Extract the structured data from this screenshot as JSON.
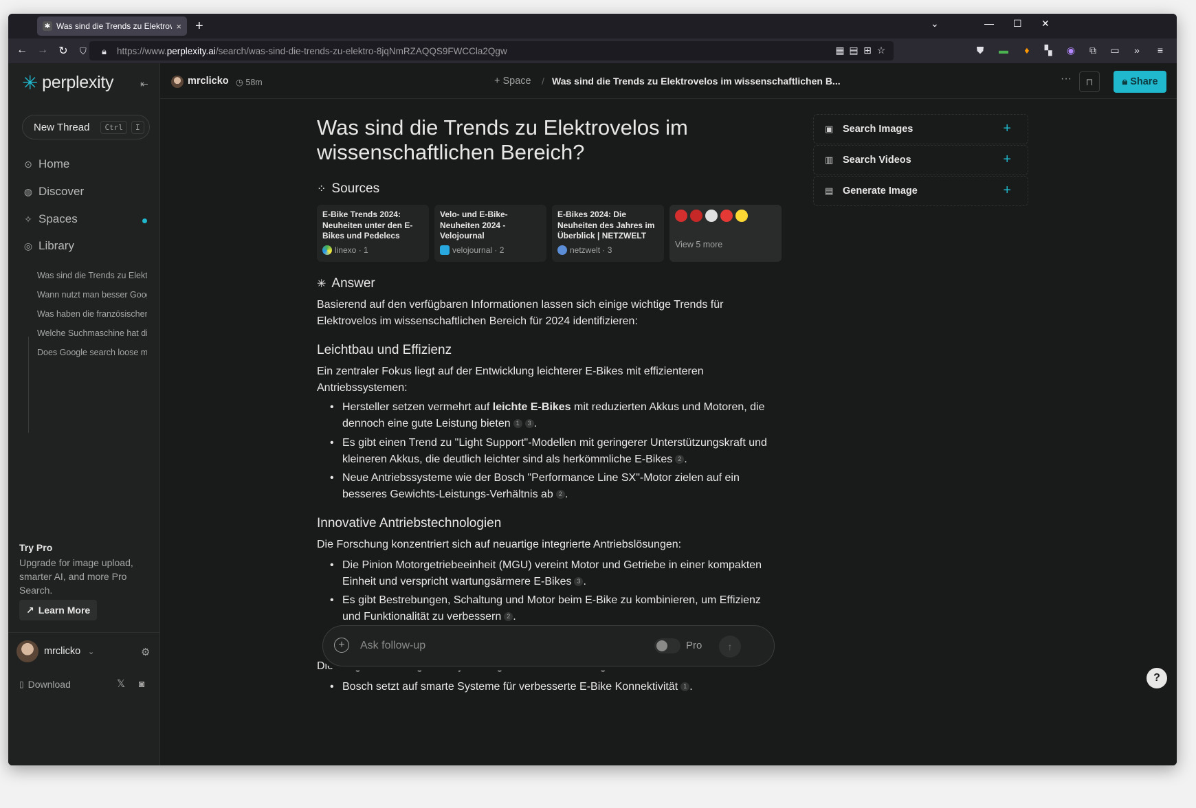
{
  "browser": {
    "tab_title": "Was sind die Trends zu Elektrovelos",
    "tab_close": "×",
    "new_tab": "+",
    "url_prefix": "https://www.",
    "url_host": "perplexity.ai",
    "url_path": "/search/was-sind-die-trends-zu-elektro-8jqNmRZAQQS9FWCCla2Qgw"
  },
  "sidebar": {
    "brand": "perplexity",
    "new_thread_label": "New Thread",
    "shortcut_key1": "Ctrl",
    "shortcut_key2": "I",
    "nav": [
      {
        "label": "Home"
      },
      {
        "label": "Discover"
      },
      {
        "label": "Spaces"
      },
      {
        "label": "Library"
      }
    ],
    "library_items": [
      "Was sind die Trends zu Elektrovelos",
      "Wann nutzt man besser Google",
      "Was haben die französischen",
      "Welche Suchmaschine hat die",
      "Does Google search loose market"
    ],
    "try_pro_title": "Try Pro",
    "try_pro_text": "Upgrade for image upload, smarter AI, and more Pro Search.",
    "learn_more": "Learn More",
    "username": "mrclicko",
    "download": "Download"
  },
  "header": {
    "username": "mrclicko",
    "time": "58m",
    "space": "Space",
    "separator": "/",
    "title": "Was sind die Trends zu Elektrovelos im wissenschaftlichen B...",
    "share": "Share"
  },
  "main": {
    "question": "Was sind die Trends zu Elektrovelos im wissenschaftlichen Bereich?",
    "sources_heading": "Sources",
    "sources": [
      {
        "title": "E-Bike Trends 2024: Neuheiten unter den E-Bikes und Pedelecs",
        "site": "linexo",
        "num": "1"
      },
      {
        "title": "Velo- und E-Bike-Neuheiten 2024 - Velojournal",
        "site": "velojournal",
        "num": "2"
      },
      {
        "title": "E-Bikes 2024: Die Neuheiten des Jahres im Überblick | NETZWELT",
        "site": "netzwelt",
        "num": "3"
      }
    ],
    "view_more": "View 5 more",
    "answer_heading": "Answer",
    "intro": "Basierend auf den verfügbaren Informationen lassen sich einige wichtige Trends für Elektrovelos im wissenschaftlichen Bereich für 2024 identifizieren:",
    "section1_title": "Leichtbau und Effizienz",
    "section1_intro": "Ein zentraler Fokus liegt auf der Entwicklung leichterer E-Bikes mit effizienteren Antriebssystemen:",
    "b1_pre": "Hersteller setzen vermehrt auf ",
    "b1_bold": "leichte E-Bikes",
    "b1_post": " mit reduzierten Akkus und Motoren, die dennoch eine gute Leistung bieten",
    "b1_c1": "1",
    "b1_c2": "3",
    "b2_text": "Es gibt einen Trend zu \"Light Support\"-Modellen mit geringerer Unterstützungskraft und kleineren Akkus, die deutlich leichter sind als herkömmliche E-Bikes",
    "b2_c1": "2",
    "b3_text": "Neue Antriebssysteme wie der Bosch \"Performance Line SX\"-Motor zielen auf ein besseres Gewichts-Leistungs-Verhältnis ab",
    "b3_c1": "2",
    "section2_title": "Innovative Antriebstechnologien",
    "section2_intro": "Die Forschung konzentriert sich auf neuartige integrierte Antriebslösungen:",
    "b4_text": "Die Pinion Motorgetriebeeinheit (MGU) vereint Motor und Getriebe in einer kompakten Einheit und verspricht wartungsärmere E-Bikes",
    "b4_c1": "3",
    "b5_text": "Es gibt Bestrebungen, Schaltung und Motor beim E-Bike zu kombinieren, um Effizienz und Funktionalität zu verbessern",
    "b5_c1": "2",
    "section3_intro": "Die Integration intelligenter Systeme gewinnt an Bedeutung:",
    "b6_text": "Bosch setzt auf smarte Systeme für verbesserte E-Bike Konnektivität",
    "b6_c1": "1"
  },
  "right_panel": {
    "search_images": "Search Images",
    "search_videos": "Search Videos",
    "generate_image": "Generate Image"
  },
  "followup": {
    "placeholder": "Ask follow-up",
    "pro_label": "Pro",
    "pro_enabled": false
  },
  "help": "?",
  "colors": {
    "accent": "#20b8cd",
    "background": "#191a1a",
    "sidebar": "#202222",
    "text": "#e8e8e6"
  }
}
